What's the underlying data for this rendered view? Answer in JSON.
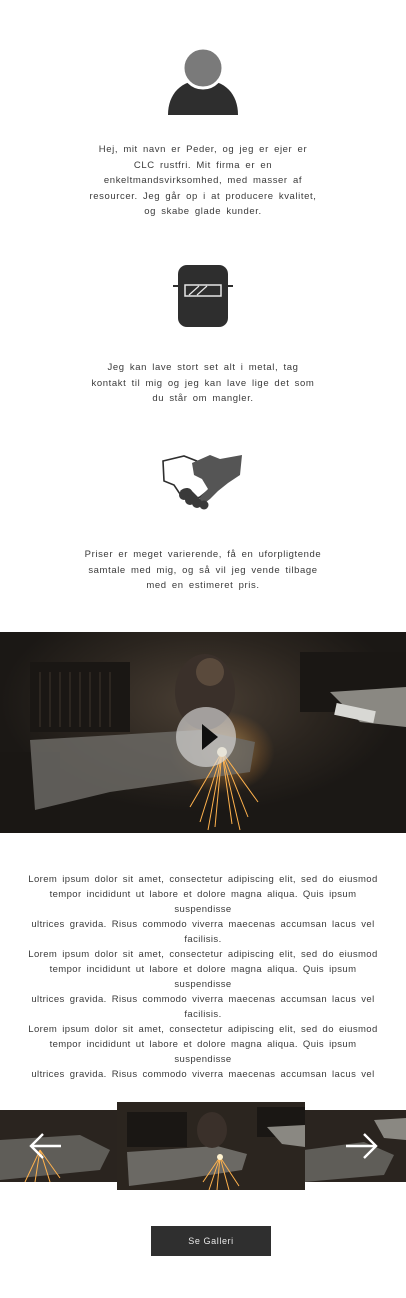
{
  "features": [
    {
      "icon": "person-icon",
      "text": [
        "Hej, mit navn er Peder, og jeg er ejer er",
        "CLC rustfri. Mit firma er en",
        "enkeltmandsvirksomhed, med masser af",
        "resourcer. Jeg går op i at producere kvalitet,",
        "og skabe glade kunder."
      ]
    },
    {
      "icon": "welding-mask-icon",
      "text": [
        "Jeg kan lave stort set alt i metal, tag",
        "kontakt til mig og jeg kan lave lige det som",
        "du står om mangler."
      ]
    },
    {
      "icon": "handshake-icon",
      "text": [
        "Priser er meget varierende, få en uforpligtende",
        "samtale med mig, og så vil jeg vende tilbage",
        "med en estimeret pris."
      ]
    }
  ],
  "video": {
    "icon": "play-icon"
  },
  "lorem": [
    "Lorem ipsum dolor sit amet, consectetur adipiscing elit, sed do eiusmod",
    "tempor incididunt ut labore et dolore magna aliqua. Quis ipsum suspendisse",
    "ultrices gravida. Risus commodo viverra maecenas accumsan lacus vel",
    "facilisis.",
    "Lorem ipsum dolor sit amet, consectetur adipiscing elit, sed do eiusmod",
    "tempor incididunt ut labore et dolore magna aliqua. Quis ipsum suspendisse",
    "ultrices gravida. Risus commodo viverra maecenas accumsan lacus vel",
    "facilisis.",
    "Lorem ipsum dolor sit amet, consectetur adipiscing elit, sed do eiusmod",
    "tempor incididunt ut labore et dolore magna aliqua. Quis ipsum suspendisse",
    "ultrices gravida. Risus commodo viverra maecenas accumsan lacus vel"
  ],
  "carousel": {
    "prev_icon": "arrow-left-icon",
    "next_icon": "arrow-right-icon"
  },
  "gallery_button": "Se Galleri",
  "colors": {
    "icon": "#333333",
    "button_bg": "#2f2f2f",
    "spark": "#ffb24d"
  }
}
